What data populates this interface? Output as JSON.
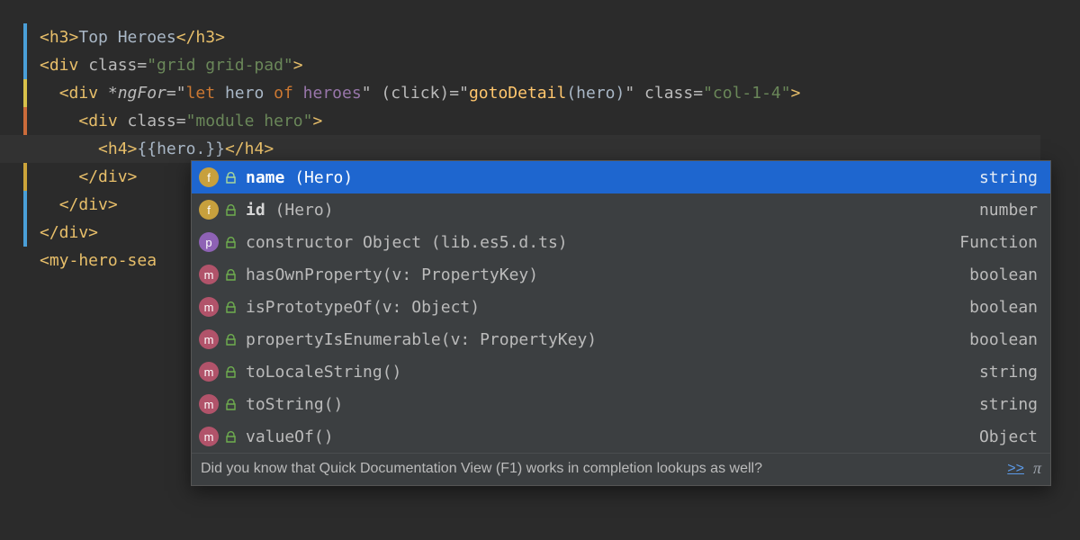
{
  "gutter_colors": [
    "#4A9FD8",
    "#4A9FD8",
    "#D8C14A",
    "#CC6B3A",
    "#CCA43A",
    "#CCA43A",
    "#4A9FD8",
    "#4A9FD8"
  ],
  "code": {
    "l1": {
      "tag_open": "<h3>",
      "text": "Top Heroes",
      "tag_close": "</h3>"
    },
    "l2": {
      "open": "<div ",
      "attr": "class=",
      "val": "\"grid grid-pad\"",
      "gt": ">"
    },
    "l3": {
      "indent": "  ",
      "open": "<div ",
      "ngfor_attr": "*ngFor",
      "eq1": "=\"",
      "kw_let": "let",
      "mid1": " hero ",
      "kw_of": "of",
      "sp": " ",
      "ident": "heroes",
      "endq1": "\"",
      "sp2": " ",
      "click_attr": "(click)=",
      "q2": "\"",
      "fn": "gotoDetail",
      "paren_open": "(",
      "arg": "hero",
      "paren_close": ")",
      "endq2": "\"",
      "sp3": " ",
      "class_attr": "class=",
      "class_val": "\"col-1-4\"",
      "gt": ">"
    },
    "l4": {
      "indent": "    ",
      "open": "<div ",
      "attr": "class=",
      "val": "\"module hero\"",
      "gt": ">"
    },
    "l5": {
      "indent": "      ",
      "open": "<h4>",
      "expr_open": "{{",
      "obj": "hero",
      "dot": ".",
      "expr_close": "}}",
      "close": "</h4>"
    },
    "l6": {
      "indent": "    ",
      "close": "</div>"
    },
    "l7": {
      "indent": "  ",
      "close": "</div>"
    },
    "l8": {
      "close": "</div>"
    },
    "l9": {
      "open_partial": "<my-hero-sea"
    }
  },
  "completion": {
    "items": [
      {
        "kind": "f",
        "name": "name",
        "tail": " (Hero)",
        "type": "string",
        "selected": true
      },
      {
        "kind": "f",
        "name": "id",
        "tail": " (Hero)",
        "type": "number"
      },
      {
        "kind": "p",
        "label": "constructor Object (lib.es5.d.ts)",
        "type": "Function"
      },
      {
        "kind": "m",
        "label": "hasOwnProperty(v: PropertyKey)",
        "type": "boolean"
      },
      {
        "kind": "m",
        "label": "isPrototypeOf(v: Object)",
        "type": "boolean"
      },
      {
        "kind": "m",
        "label": "propertyIsEnumerable(v: PropertyKey)",
        "type": "boolean"
      },
      {
        "kind": "m",
        "label": "toLocaleString()",
        "type": "string"
      },
      {
        "kind": "m",
        "label": "toString()",
        "type": "string"
      },
      {
        "kind": "m",
        "label": "valueOf()",
        "type": "Object"
      }
    ],
    "tip_text": "Did you know that Quick Documentation View (F1) works in completion lookups as well?",
    "tip_link": ">>",
    "tip_pi": "π"
  }
}
